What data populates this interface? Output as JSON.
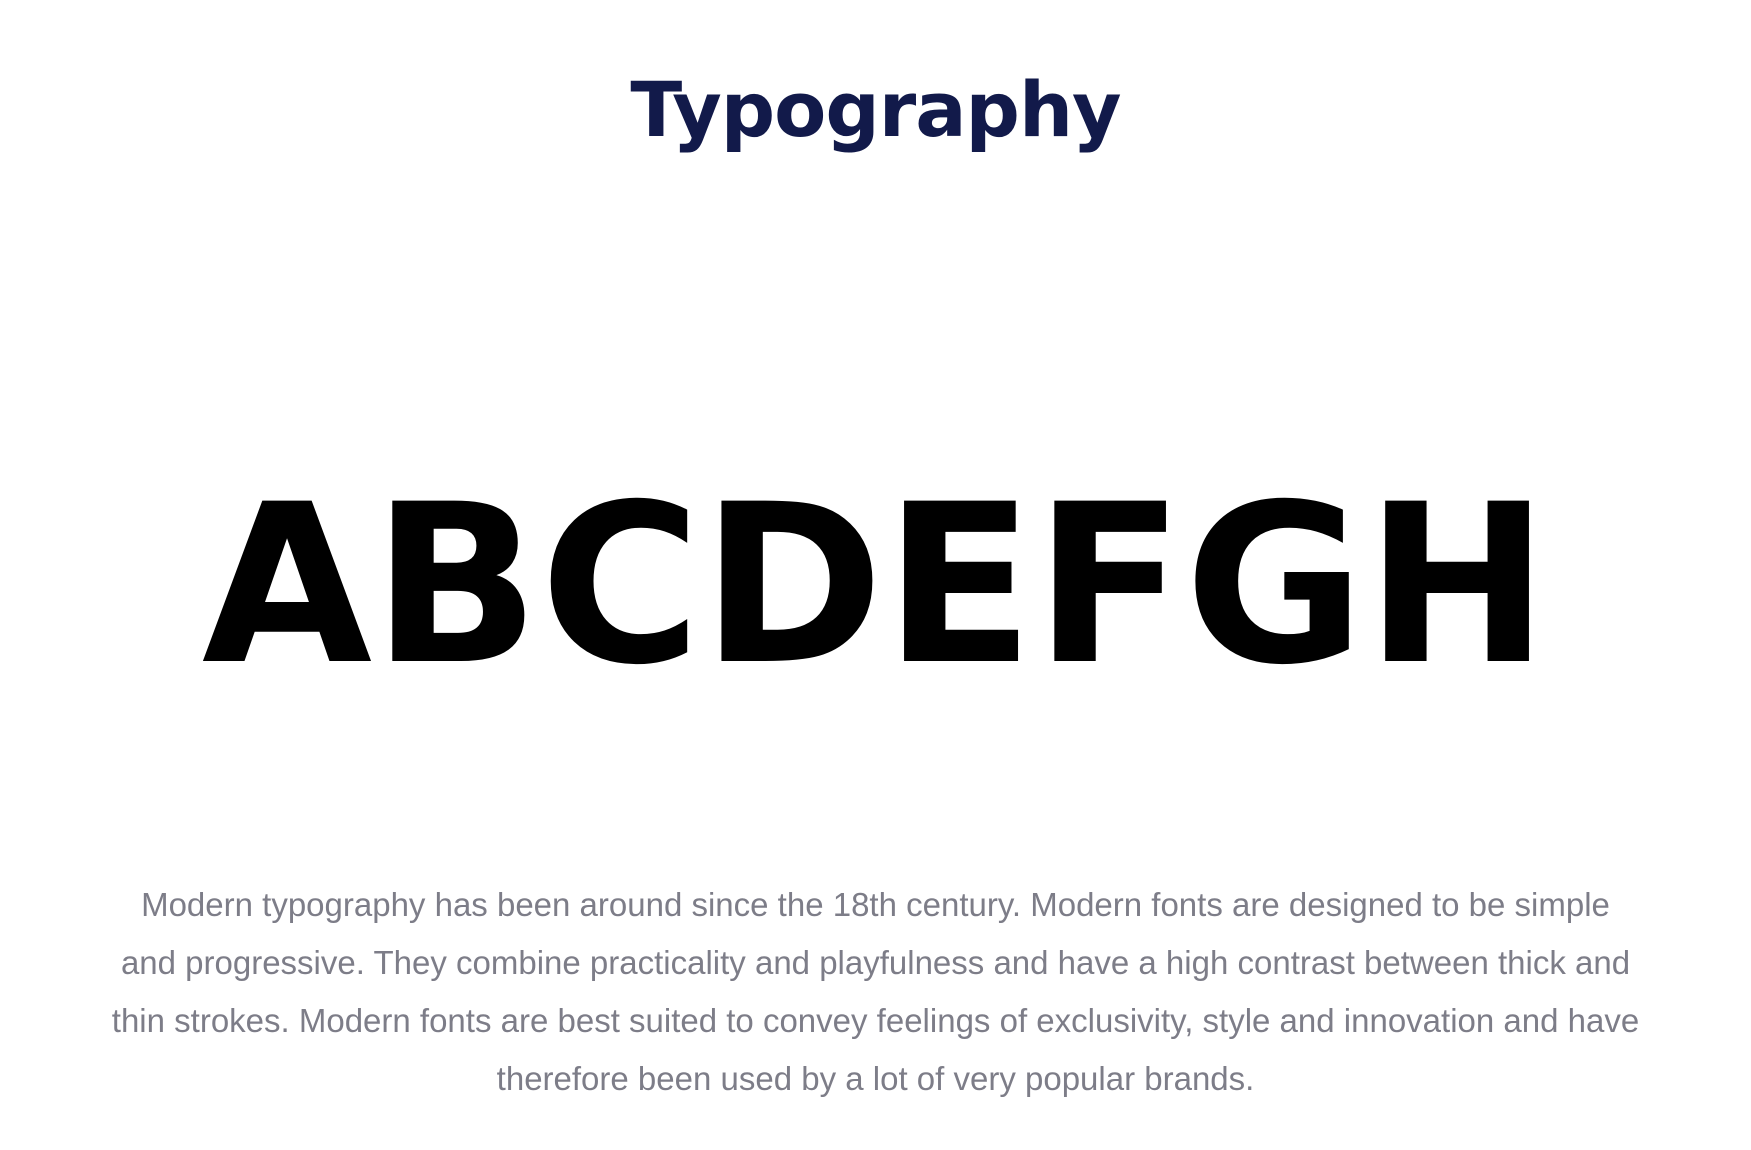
{
  "section": {
    "title": "Typography",
    "specimen": "ABCDEFGH",
    "description": "Modern typography has been around since the 18th century. Modern fonts are designed to be simple and progressive. They combine practicality and playfulness and have a high contrast between thick and thin strokes. Modern fonts are best suited to convey feelings of exclusivity, style and innovation and have therefore been used by a lot of very popular brands."
  },
  "colors": {
    "title": "#121a4a",
    "specimen": "#000000",
    "description": "#7d7d88",
    "background": "#ffffff"
  }
}
